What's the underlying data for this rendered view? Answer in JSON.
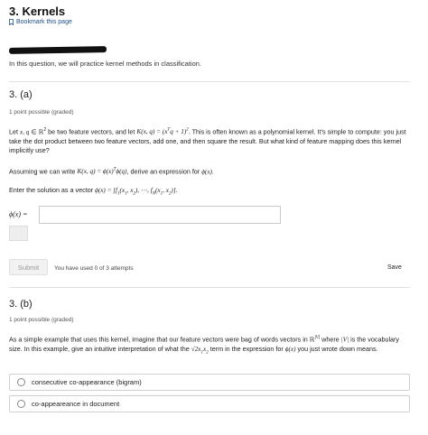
{
  "header": {
    "title": "3. Kernels",
    "bookmark_label": "Bookmark this page"
  },
  "intro": "In this question, we will practice kernel methods in classification.",
  "question_a": {
    "heading": "3. (a)",
    "points": "1 point possible (graded)",
    "p1_a": "Let ",
    "p1_b": " be two feature vectors, and let ",
    "p1_c": ". This is often known as a polynomial kernel. It's simple to compute: you just take the dot product between two feature vectors, add one, and then square the result. But what kind of feature mapping does this kernel implicitly use?",
    "p2_a": "Assuming we can write ",
    "p2_b": ", derive an expression for ",
    "p3_a": "Enter the solution as a vector ",
    "answer_value": "",
    "submit_label": "Submit",
    "attempts": "You have used 0 of 3 attempts",
    "save_label": "Save"
  },
  "question_b": {
    "heading": "3. (b)",
    "points": "1 point possible (graded)",
    "p1_a": "As a simple example that uses this kernel, imagine that our feature vectors were bag of words vectors in ",
    "p1_b": " where ",
    "p1_c": " is the vocabulary size. In this example, give an intuitive interpretation of what the ",
    "p1_d": " term in the expression for ",
    "p1_e": " you just wrote down means.",
    "options": [
      "consecutive co-appearance (bigram)",
      "co-appeareance in document"
    ]
  },
  "colors": {
    "link": "#1f4e8c",
    "border": "#c9c9c9"
  },
  "icons": {
    "bookmark": "bookmark-icon",
    "radio": "radio-icon"
  }
}
